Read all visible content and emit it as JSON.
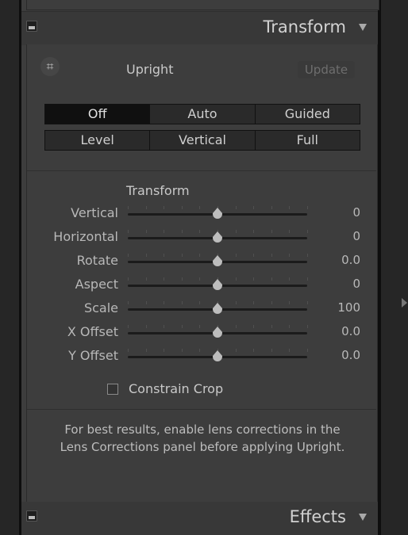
{
  "transform_header": {
    "title": "Transform"
  },
  "effects_header": {
    "title": "Effects"
  },
  "upright": {
    "label": "Upright",
    "update_label": "Update",
    "mode_row1": [
      "Off",
      "Auto",
      "Guided"
    ],
    "mode_row2": [
      "Level",
      "Vertical",
      "Full"
    ],
    "selected": "Off"
  },
  "transform": {
    "label": "Transform",
    "sliders": [
      {
        "name": "Vertical",
        "value": "0",
        "position": 0.5
      },
      {
        "name": "Horizontal",
        "value": "0",
        "position": 0.5
      },
      {
        "name": "Rotate",
        "value": "0.0",
        "position": 0.5
      },
      {
        "name": "Aspect",
        "value": "0",
        "position": 0.5
      },
      {
        "name": "Scale",
        "value": "100",
        "position": 0.5
      },
      {
        "name": "X Offset",
        "value": "0.0",
        "position": 0.5
      },
      {
        "name": "Y Offset",
        "value": "0.0",
        "position": 0.5
      }
    ]
  },
  "constrain_crop": {
    "label": "Constrain Crop",
    "checked": false
  },
  "note": {
    "line1": "For best results, enable lens corrections in the",
    "line2": "Lens Corrections panel before applying Upright."
  },
  "icons": {
    "upright_icon": "grid-hash-icon",
    "collapse": "triangle-down-icon"
  }
}
